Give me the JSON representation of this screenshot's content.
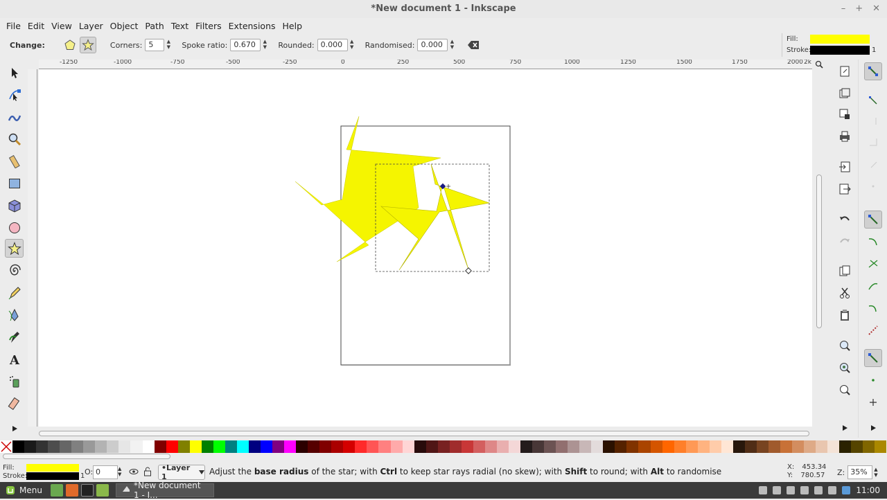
{
  "window": {
    "title": "*New document 1 - Inkscape",
    "minimize": "–",
    "maximize": "+",
    "close": "✕"
  },
  "menubar": [
    "File",
    "Edit",
    "View",
    "Layer",
    "Object",
    "Path",
    "Text",
    "Filters",
    "Extensions",
    "Help"
  ],
  "tool_controls": {
    "change_label": "Change:",
    "corners_label": "Corners:",
    "corners_value": "5",
    "spoke_label": "Spoke ratio:",
    "spoke_value": "0.670",
    "rounded_label": "Rounded:",
    "rounded_value": "0.000",
    "randomised_label": "Randomised:",
    "randomised_value": "0.000"
  },
  "fill_stroke": {
    "fill_label": "Fill:",
    "stroke_label": "Stroke:",
    "stroke_width": "1",
    "fill_color": "#ffff00",
    "stroke_color": "#000000"
  },
  "ruler": {
    "ticks": [
      "-1250",
      "-1000",
      "-750",
      "-500",
      "-250",
      "0",
      "250",
      "500",
      "750",
      "1000",
      "1250",
      "1500",
      "1750",
      "2000",
      "2k"
    ]
  },
  "palette": [
    "#000000",
    "#1a1a1a",
    "#333333",
    "#4d4d4d",
    "#666666",
    "#808080",
    "#999999",
    "#b3b3b3",
    "#cccccc",
    "#e6e6e6",
    "#f2f2f2",
    "#ffffff",
    "#800000",
    "#ff0000",
    "#808000",
    "#ffff00",
    "#008000",
    "#00ff00",
    "#008080",
    "#00ffff",
    "#000080",
    "#0000ff",
    "#800080",
    "#ff00ff",
    "#2b0000",
    "#550000",
    "#800000",
    "#aa0000",
    "#d40000",
    "#ff2a2a",
    "#ff5555",
    "#ff8080",
    "#ffaaaa",
    "#ffd5d5",
    "#280b0b",
    "#501616",
    "#782121",
    "#a02c2c",
    "#c83737",
    "#d35f5f",
    "#de8787",
    "#e9afaf",
    "#f4d7d7",
    "#241c1c",
    "#483737",
    "#6c5353",
    "#916f6f",
    "#ac9393",
    "#c8b7b7",
    "#e3dbdb",
    "#2b1100",
    "#552200",
    "#803300",
    "#aa4400",
    "#d45500",
    "#ff6600",
    "#ff7f2a",
    "#ff9955",
    "#ffb380",
    "#ffccaa",
    "#ffe6d5",
    "#28170b",
    "#502d16",
    "#784421",
    "#a05a2c",
    "#c87137",
    "#d38d5f",
    "#deaa87",
    "#e9c6af",
    "#f4e3d7",
    "#2b2200",
    "#554400",
    "#806600",
    "#aa8800"
  ],
  "status": {
    "fill_label": "Fill:",
    "stroke_label": "Stroke:",
    "stroke_width": "1",
    "opacity_label": "O:",
    "opacity_value": "0",
    "layer": "•Layer 1",
    "message_pre": "Adjust the ",
    "message_b1": "base radius",
    "message_mid1": " of the star; with ",
    "message_b2": "Ctrl",
    "message_mid2": " to keep star rays radial (no skew); with ",
    "message_b3": "Shift",
    "message_mid3": " to round; with ",
    "message_b4": "Alt",
    "message_end": " to randomise",
    "x_label": "X:",
    "x_value": "453.34",
    "y_label": "Y:",
    "y_value": "780.57",
    "zoom_label": "Z:",
    "zoom_value": "35%"
  },
  "taskbar": {
    "menu_label": "Menu",
    "window_label": "*New document 1 - I...",
    "clock": "11:00"
  }
}
